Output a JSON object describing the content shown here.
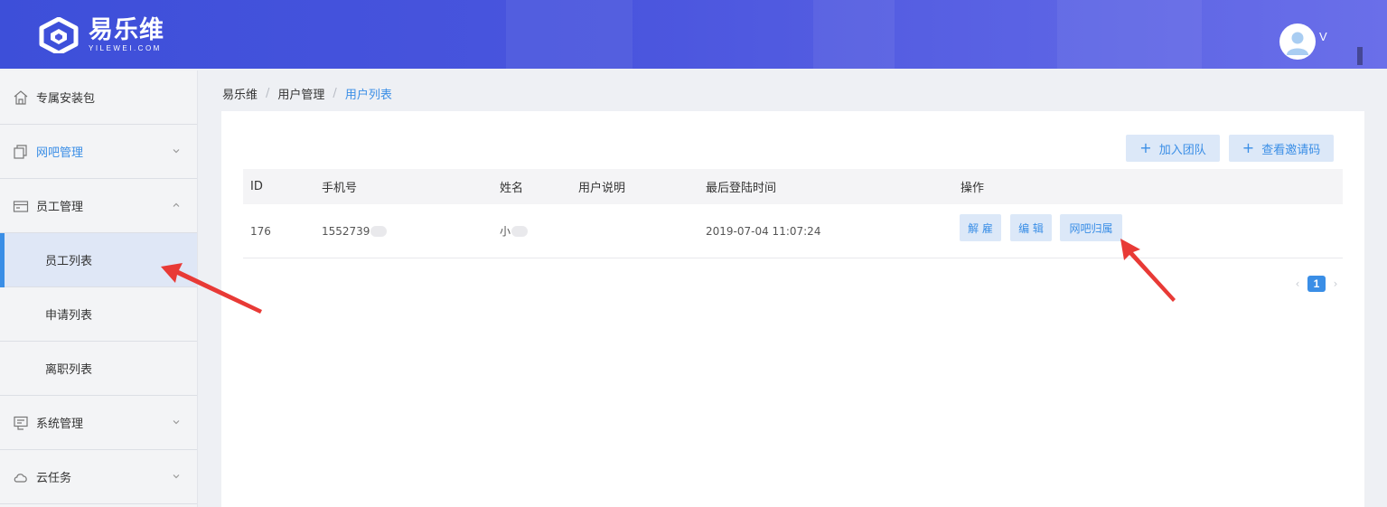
{
  "header": {
    "logo_cn": "易乐维",
    "logo_en": "YILEWEI.COM",
    "username": "V",
    "gradient_start": "#3d4fd9",
    "gradient_end": "#6a6fe9"
  },
  "sidebar": {
    "items": [
      {
        "label": "专属安装包",
        "icon": "house-icon"
      },
      {
        "label": "网吧管理",
        "icon": "copy-icon",
        "caret": "chevron-down-icon"
      },
      {
        "label": "员工管理",
        "icon": "card-icon",
        "caret": "chevron-up-icon"
      },
      {
        "label": "员工列表",
        "active": true
      },
      {
        "label": "申请列表"
      },
      {
        "label": "离职列表"
      },
      {
        "label": "系统管理",
        "icon": "document-icon",
        "caret": "chevron-down-icon"
      },
      {
        "label": "云任务",
        "icon": "cloud-icon",
        "caret": "chevron-down-icon"
      }
    ]
  },
  "breadcrumb": [
    "易乐维",
    "用户管理",
    "用户列表"
  ],
  "toolbar": {
    "join_team": "加入团队",
    "view_invite": "查看邀请码"
  },
  "table": {
    "columns": [
      "ID",
      "手机号",
      "姓名",
      "用户说明",
      "最后登陆时间",
      "操作"
    ],
    "rows": [
      {
        "id": "176",
        "phone": "1552739",
        "name": "小",
        "note": "",
        "last_login": "2019-07-04 11:07:24",
        "actions": [
          "解 雇",
          "编 辑",
          "网吧归属"
        ]
      }
    ]
  },
  "pagination": {
    "current": "1",
    "prev": "‹",
    "next": "›"
  },
  "colors": {
    "accent": "#3a8ee6",
    "button_bg": "#dce8f8",
    "annotation": "#e83a36"
  }
}
